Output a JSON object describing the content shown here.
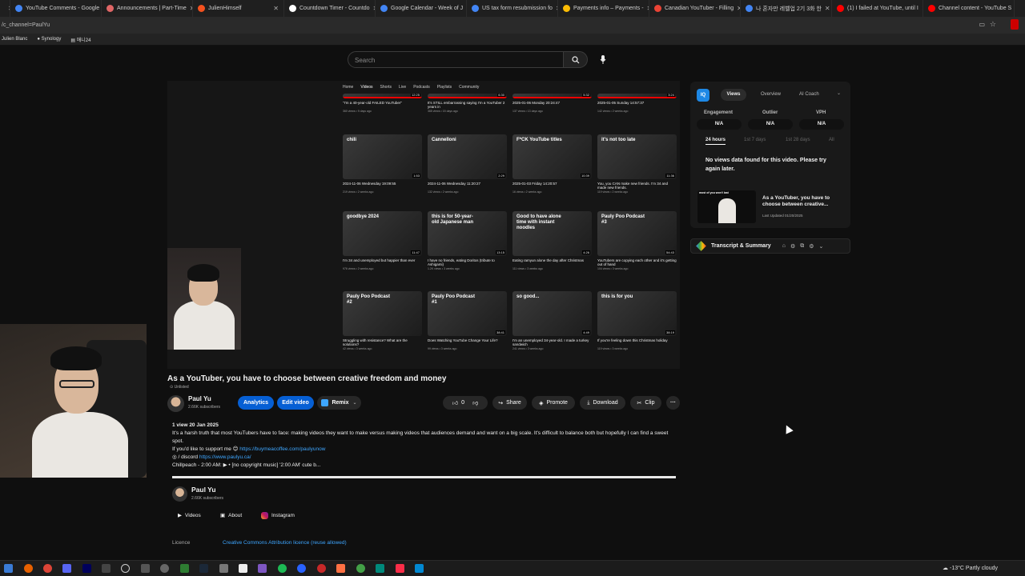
{
  "tabs": [
    {
      "label": "YouTube Comments - Google",
      "color": "#4285f4"
    },
    {
      "label": "Announcements | Part-Time",
      "color": "#e06666"
    },
    {
      "label": "JulienHimself",
      "color": "#f4511e"
    },
    {
      "label": "Countdown Timer - Countdo",
      "color": "#ffffff"
    },
    {
      "label": "Google Calendar - Week of J",
      "color": "#4285f4"
    },
    {
      "label": "US tax form resubmission fo",
      "color": "#4285f4"
    },
    {
      "label": "Payments info – Payments -",
      "color": "#fbbc04"
    },
    {
      "label": "Canadian YouTuber - Filling",
      "color": "#ea4335"
    },
    {
      "label": "나 혼자만 레벨업 2기 3화 한",
      "color": "#4285f4"
    },
    {
      "label": "(1) I failed at YouTube, until I",
      "color": "#ff0000"
    },
    {
      "label": "Channel content - YouTube S",
      "color": "#ff0000"
    }
  ],
  "address": "/c_channel=PaulYu",
  "bookmarks": [
    "Julien Blanc",
    "Synology",
    "애니24"
  ],
  "search": {
    "placeholder": "Search"
  },
  "player": {
    "nav": [
      "Home",
      "Videos",
      "Shorts",
      "Live",
      "Podcasts",
      "Playlists",
      "Community"
    ],
    "videos": [
      {
        "thumb": "",
        "dur": "12:25",
        "title": "\"I'm a 40-year-old FAILED YouTuber\"",
        "meta": "360 views • 9 days ago"
      },
      {
        "thumb": "",
        "dur": "6:30",
        "title": "It's STILL embarrassing saying I'm a YouTuber 2 years in",
        "meta": "365 views • 15 days ago"
      },
      {
        "thumb": "",
        "dur": "5:32",
        "title": "2025-01-06 Monday 20:24:47",
        "meta": "137 views • 13 days ago"
      },
      {
        "thumb": "",
        "dur": "3:24",
        "title": "2025-01-05 Sunday 14:57:37",
        "meta": "142 views • 2 weeks ago"
      },
      {
        "thumb": "chili",
        "dur": "1:53",
        "title": "2024-11-06 Wednesday 19:09:55",
        "meta": "219 views • 2 weeks ago"
      },
      {
        "thumb": "Cannelloni",
        "dur": "2:29",
        "title": "2024-11-06 Wednesday 11:20:27",
        "meta": "132 views • 2 weeks ago"
      },
      {
        "thumb": "F*CK YouTube titles",
        "dur": "10:39",
        "title": "2025-01-03 Friday 14:20:57",
        "meta": "16 views • 2 weeks ago"
      },
      {
        "thumb": "it's not too late",
        "dur": "11:36",
        "title": "You, you CAN make new friends. I'm 34 and made new friends.",
        "meta": "119 views • 2 weeks ago"
      },
      {
        "thumb": "goodbye 2024",
        "dur": "11:47",
        "title": "I'm 34 and unemployed but happier than ever",
        "meta": "976 views • 2 weeks ago"
      },
      {
        "thumb": "this is for 50-year-old Japanese man",
        "dur": "13:15",
        "title": "I have no friends, eating Doritos (tribute to Ashigami)",
        "meta": "1.2K views • 3 weeks ago"
      },
      {
        "thumb": "Good to have alone time with instant noodles",
        "dur": "4:26",
        "title": "Eating ramyun alone the day after Christmas",
        "meta": "111 views • 3 weeks ago"
      },
      {
        "thumb": "Pauly Poo Podcast #3",
        "dur": "54:43",
        "title": "YouTubers are copying each other and it's getting out of hand",
        "meta": "104 views • 3 weeks ago"
      },
      {
        "thumb": "Pauly Poo Podcast #2",
        "dur": "",
        "title": "Struggling with resistance? What are the solutions?",
        "meta": "42 views • 3 weeks ago"
      },
      {
        "thumb": "Pauly Poo Podcast #1",
        "dur": "38:41",
        "title": "Does Watching YouTube Change Your Life?",
        "meta": "99 views • 3 weeks ago"
      },
      {
        "thumb": "so good...",
        "dur": "4:49",
        "title": "I'm an unemployed 34-year-old. I made a turkey sandwich",
        "meta": "241 views • 3 weeks ago"
      },
      {
        "thumb": "this is for you",
        "dur": "38:19",
        "title": "If you're feeling down this Christmas holiday",
        "meta": "119 views • 3 weeks ago"
      }
    ]
  },
  "video": {
    "title": "As a YouTuber, you have to choose between creative freedom and money",
    "visibility": "Unlisted",
    "channel": "Paul Yu",
    "subscribers": "2.66K subscribers",
    "analytics": "Analytics",
    "edit": "Edit video",
    "remix": "Remix",
    "likes": "0",
    "share": "Share",
    "promote": "Promote",
    "download": "Download",
    "clip": "Clip",
    "more": "···"
  },
  "description": {
    "stats": "1 view  20 Jan 2025",
    "line1": "It's a harsh truth that most YouTubers have to face: making videos they want to make versus making videos that audiences demand and want on a big scale. It's difficult to balance both but hopefully I can find a sweet spot.",
    "support_label": "If you'd like to support me 😊",
    "support_link": "https://buymeacoffee.com/paulyunow",
    "discord_label": "◎ / discord",
    "discord_link": "https://www.paulyu.ca/",
    "music": "Chillpeach - 2:00 AM:  ▶ • [no copyright music] '2:00 AM' cute b..."
  },
  "channel_card": {
    "name": "Paul Yu",
    "subs": "2.66K subscribers",
    "links": [
      "Videos",
      "About",
      "Instagram"
    ]
  },
  "licence": {
    "label": "Licence",
    "value": "Creative Commons Attribution licence (reuse allowed)"
  },
  "vidiq": {
    "tabs": [
      "Views",
      "Overview",
      "AI Coach"
    ],
    "metrics": [
      {
        "label": "Engagement",
        "value": "N/A"
      },
      {
        "label": "Outlier",
        "value": "N/A"
      },
      {
        "label": "VPH",
        "value": "N/A"
      }
    ],
    "ranges": [
      "24 hours",
      "1st 7 days",
      "1st 28 days",
      "All"
    ],
    "no_data": "No views data found for this video. Please try again later.",
    "card_title": "As a YouTuber, you have to choose between creative...",
    "card_updated": "Last Updated 01/20/2025",
    "card_thumb_text": "most of you won't last"
  },
  "transcript": {
    "label": "Transcript & Summary"
  },
  "taskbar": {
    "weather": "-13°C  Partly cloudy"
  },
  "colors": {
    "accent_blue": "#3ea6ff",
    "brand_red": "#ff0000",
    "pill_blue": "#065fd4"
  }
}
